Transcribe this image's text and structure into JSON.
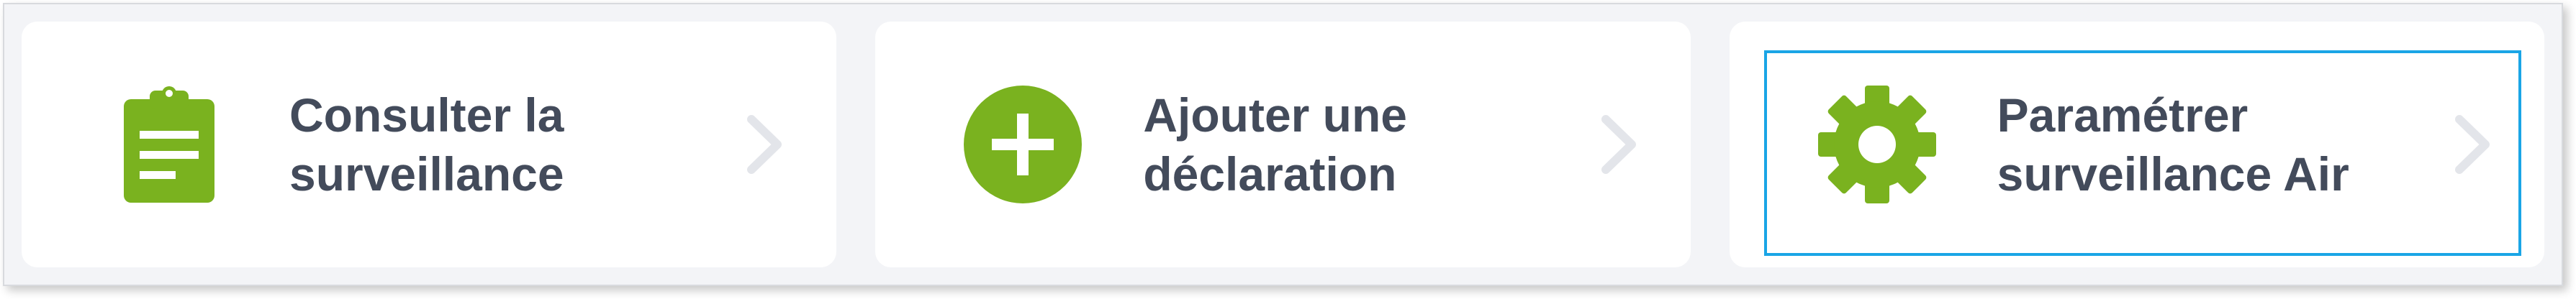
{
  "colors": {
    "accent_green": "#7ab21f",
    "text": "#434b5b",
    "chevron": "#e3e5ea",
    "focus": "#1aa5e6",
    "background": "#f3f4f7",
    "card": "#ffffff"
  },
  "cards": [
    {
      "icon": "clipboard-icon",
      "line1": "Consulter la",
      "line2": "surveillance",
      "focused": false
    },
    {
      "icon": "plus-circle-icon",
      "line1": "Ajouter une",
      "line2": "déclaration",
      "focused": false
    },
    {
      "icon": "gear-icon",
      "line1": "Paramétrer",
      "line2": "surveillance Air",
      "focused": true
    }
  ]
}
